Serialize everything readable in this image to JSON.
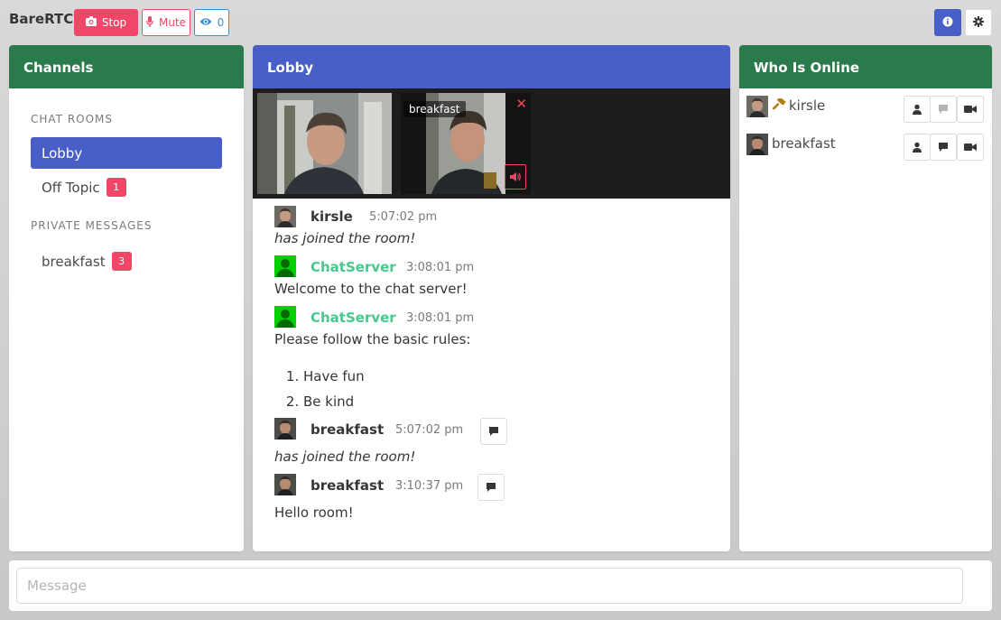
{
  "app": {
    "title": "BareRTC",
    "stop_label": "Stop",
    "mute_label": "Mute",
    "watchers_count": "0"
  },
  "channels": {
    "title": "Channels",
    "chat_rooms_label": "CHAT ROOMS",
    "rooms": [
      {
        "name": "Lobby",
        "badge": ""
      },
      {
        "name": "Off Topic",
        "badge": "1"
      }
    ],
    "private_messages_label": "PRIVATE MESSAGES",
    "dms": [
      {
        "name": "breakfast",
        "badge": "3"
      }
    ]
  },
  "lobby": {
    "title": "Lobby",
    "videos": [
      {
        "label": ""
      },
      {
        "label": "breakfast"
      }
    ],
    "messages": [
      {
        "user": "kirsle",
        "time": "5:07:02 pm",
        "text": "has joined the room!"
      },
      {
        "user": "ChatServer",
        "time": "3:08:01 pm",
        "text": "Welcome to the chat server!"
      },
      {
        "user": "ChatServer",
        "time": "3:08:01 pm",
        "text": "Please follow the basic rules:",
        "rules": [
          "Have fun",
          "Be kind"
        ]
      },
      {
        "user": "breakfast",
        "time": "5:07:02 pm",
        "text": "has joined the room!"
      },
      {
        "user": "breakfast",
        "time": "3:10:37 pm",
        "text": "Hello room!"
      }
    ]
  },
  "online": {
    "title": "Who Is Online",
    "users": [
      {
        "name": "kirsle",
        "is_operator": true
      },
      {
        "name": "breakfast",
        "is_operator": false
      }
    ]
  },
  "composer": {
    "placeholder": "Message"
  },
  "colors": {
    "primary": "#485fc7",
    "success_dark": "#2b7a4b",
    "danger": "#f14668",
    "info": "#3e8ed0",
    "server_name": "#48c78e"
  }
}
